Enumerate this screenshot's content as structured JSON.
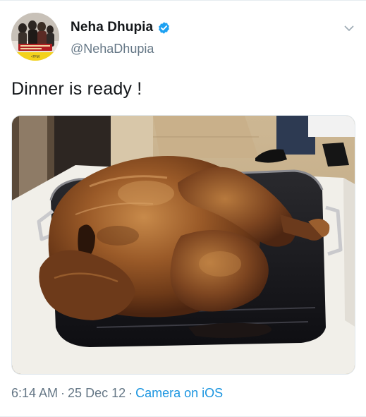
{
  "tweet": {
    "author": {
      "display_name": "Neha Dhupia",
      "handle": "@NehaDhupia",
      "verified": true,
      "avatar_icon": "avatar-poster-image",
      "avatar_caption": "•7FM"
    },
    "menu_icon": "chevron-down-icon",
    "text": "Dinner is ready !",
    "media": {
      "type": "photo",
      "subject": "roast-turkey-image"
    },
    "meta": {
      "time": "6:14 AM",
      "separator": "·",
      "date": "25 Dec 12",
      "source": "Camera on iOS"
    }
  },
  "colors": {
    "text_primary": "#14171a",
    "text_secondary": "#657786",
    "link": "#1b95e0",
    "verified_badge": "#1da1f2",
    "divider": "#e6ecf0"
  }
}
